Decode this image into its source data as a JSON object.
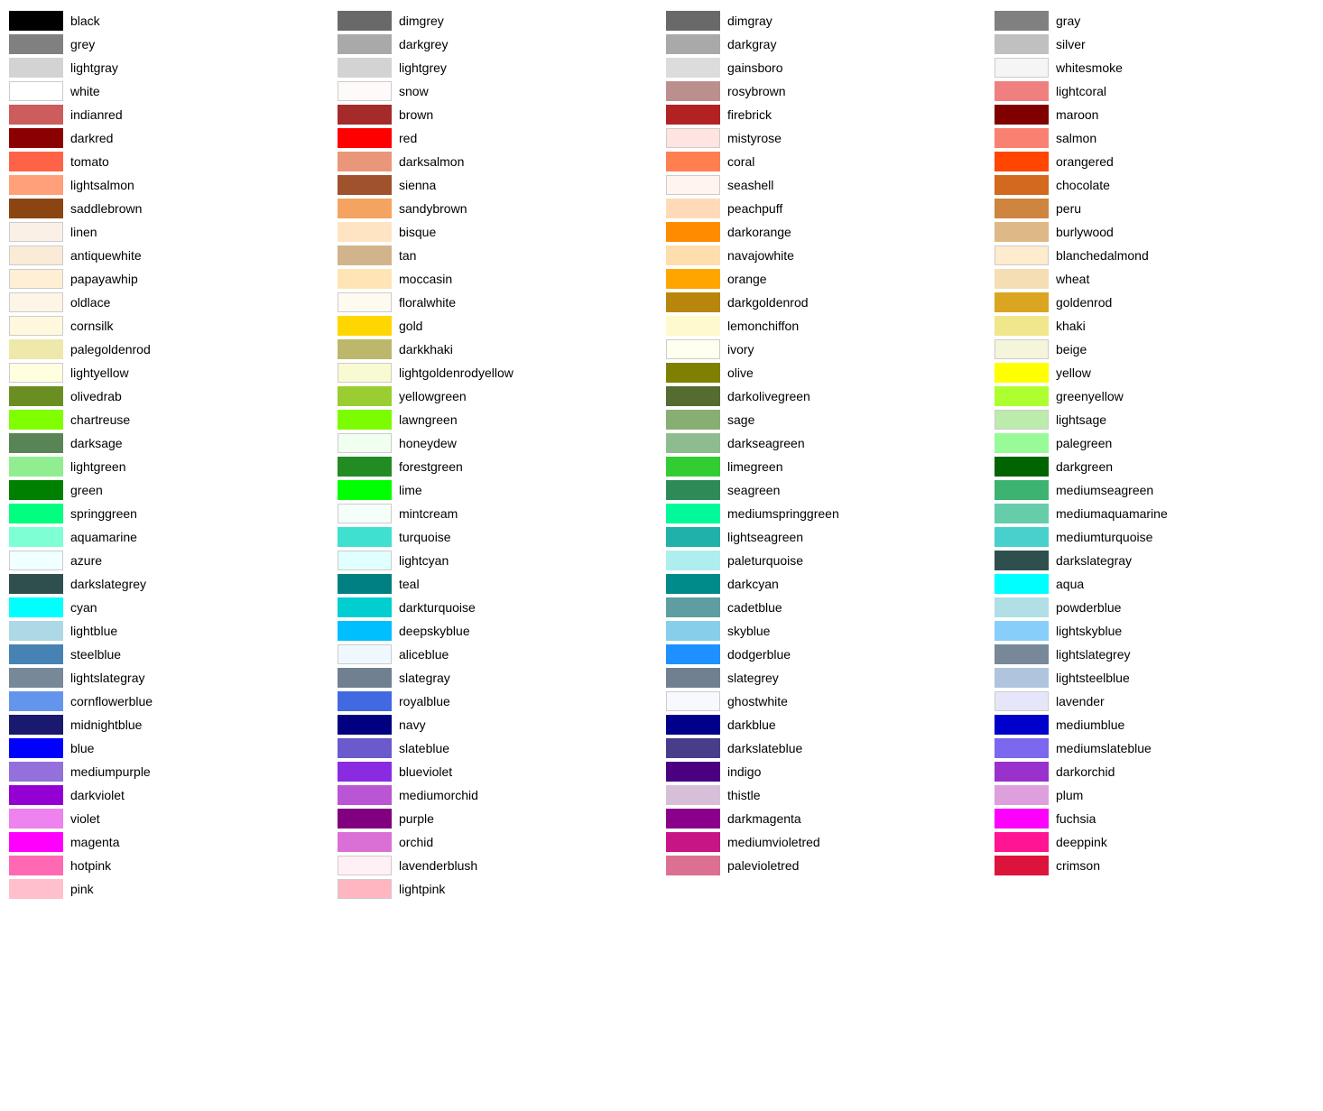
{
  "columns": [
    {
      "id": "col1",
      "items": [
        {
          "name": "black",
          "color": "#000000"
        },
        {
          "name": "grey",
          "color": "#808080"
        },
        {
          "name": "lightgray",
          "color": "#d3d3d3"
        },
        {
          "name": "white",
          "color": "#ffffff"
        },
        {
          "name": "indianred",
          "color": "#cd5c5c"
        },
        {
          "name": "darkred",
          "color": "#8b0000"
        },
        {
          "name": "tomato",
          "color": "#ff6347"
        },
        {
          "name": "lightsalmon",
          "color": "#ffa07a"
        },
        {
          "name": "saddlebrown",
          "color": "#8b4513"
        },
        {
          "name": "linen",
          "color": "#faf0e6"
        },
        {
          "name": "antiquewhite",
          "color": "#faebd7"
        },
        {
          "name": "papayawhip",
          "color": "#ffefd5"
        },
        {
          "name": "oldlace",
          "color": "#fdf5e6"
        },
        {
          "name": "cornsilk",
          "color": "#fff8dc"
        },
        {
          "name": "palegoldenrod",
          "color": "#eee8aa"
        },
        {
          "name": "lightyellow",
          "color": "#ffffe0"
        },
        {
          "name": "olivedrab",
          "color": "#6b8e23"
        },
        {
          "name": "chartreuse",
          "color": "#7fff00"
        },
        {
          "name": "darksage",
          "color": "#598556"
        },
        {
          "name": "lightgreen",
          "color": "#90ee90"
        },
        {
          "name": "green",
          "color": "#008000"
        },
        {
          "name": "springgreen",
          "color": "#00ff7f"
        },
        {
          "name": "aquamarine",
          "color": "#7fffd4"
        },
        {
          "name": "azure",
          "color": "#f0ffff"
        },
        {
          "name": "darkslategrey",
          "color": "#2f4f4f"
        },
        {
          "name": "cyan",
          "color": "#00ffff"
        },
        {
          "name": "lightblue",
          "color": "#add8e6"
        },
        {
          "name": "steelblue",
          "color": "#4682b4"
        },
        {
          "name": "lightslategray",
          "color": "#778899"
        },
        {
          "name": "cornflowerblue",
          "color": "#6495ed"
        },
        {
          "name": "midnightblue",
          "color": "#191970"
        },
        {
          "name": "blue",
          "color": "#0000ff"
        },
        {
          "name": "mediumpurple",
          "color": "#9370db"
        },
        {
          "name": "darkviolet",
          "color": "#9400d3"
        },
        {
          "name": "violet",
          "color": "#ee82ee"
        },
        {
          "name": "magenta",
          "color": "#ff00ff"
        },
        {
          "name": "hotpink",
          "color": "#ff69b4"
        },
        {
          "name": "pink",
          "color": "#ffc0cb"
        }
      ]
    },
    {
      "id": "col2",
      "items": [
        {
          "name": "dimgrey",
          "color": "#696969"
        },
        {
          "name": "darkgrey",
          "color": "#a9a9a9"
        },
        {
          "name": "lightgrey",
          "color": "#d3d3d3"
        },
        {
          "name": "snow",
          "color": "#fffafa"
        },
        {
          "name": "brown",
          "color": "#a52a2a"
        },
        {
          "name": "red",
          "color": "#ff0000"
        },
        {
          "name": "darksalmon",
          "color": "#e9967a"
        },
        {
          "name": "sienna",
          "color": "#a0522d"
        },
        {
          "name": "sandybrown",
          "color": "#f4a460"
        },
        {
          "name": "bisque",
          "color": "#ffe4c4"
        },
        {
          "name": "tan",
          "color": "#d2b48c"
        },
        {
          "name": "moccasin",
          "color": "#ffe4b5"
        },
        {
          "name": "floralwhite",
          "color": "#fffaf0"
        },
        {
          "name": "gold",
          "color": "#ffd700"
        },
        {
          "name": "darkkhaki",
          "color": "#bdb76b"
        },
        {
          "name": "lightgoldenrodyellow",
          "color": "#fafad2"
        },
        {
          "name": "yellowgreen",
          "color": "#9acd32"
        },
        {
          "name": "lawngreen",
          "color": "#7cfc00"
        },
        {
          "name": "honeydew",
          "color": "#f0fff0"
        },
        {
          "name": "forestgreen",
          "color": "#228b22"
        },
        {
          "name": "lime",
          "color": "#00ff00"
        },
        {
          "name": "mintcream",
          "color": "#f5fffa"
        },
        {
          "name": "turquoise",
          "color": "#40e0d0"
        },
        {
          "name": "lightcyan",
          "color": "#e0ffff"
        },
        {
          "name": "teal",
          "color": "#008080"
        },
        {
          "name": "darkturquoise",
          "color": "#00ced1"
        },
        {
          "name": "deepskyblue",
          "color": "#00bfff"
        },
        {
          "name": "aliceblue",
          "color": "#f0f8ff"
        },
        {
          "name": "slategray",
          "color": "#708090"
        },
        {
          "name": "royalblue",
          "color": "#4169e1"
        },
        {
          "name": "navy",
          "color": "#000080"
        },
        {
          "name": "slateblue",
          "color": "#6a5acd"
        },
        {
          "name": "blueviolet",
          "color": "#8a2be2"
        },
        {
          "name": "mediumorchid",
          "color": "#ba55d3"
        },
        {
          "name": "purple",
          "color": "#800080"
        },
        {
          "name": "orchid",
          "color": "#da70d6"
        },
        {
          "name": "lavenderblush",
          "color": "#fff0f5"
        },
        {
          "name": "lightpink",
          "color": "#ffb6c1"
        }
      ]
    },
    {
      "id": "col3",
      "items": [
        {
          "name": "dimgray",
          "color": "#696969"
        },
        {
          "name": "darkgray",
          "color": "#a9a9a9"
        },
        {
          "name": "gainsboro",
          "color": "#dcdcdc"
        },
        {
          "name": "rosybrown",
          "color": "#bc8f8f"
        },
        {
          "name": "firebrick",
          "color": "#b22222"
        },
        {
          "name": "mistyrose",
          "color": "#ffe4e1"
        },
        {
          "name": "coral",
          "color": "#ff7f50"
        },
        {
          "name": "seashell",
          "color": "#fff5ee"
        },
        {
          "name": "peachpuff",
          "color": "#ffdab9"
        },
        {
          "name": "darkorange",
          "color": "#ff8c00"
        },
        {
          "name": "navajowhite",
          "color": "#ffdead"
        },
        {
          "name": "orange",
          "color": "#ffa500"
        },
        {
          "name": "darkgoldenrod",
          "color": "#b8860b"
        },
        {
          "name": "lemonchiffon",
          "color": "#fffacd"
        },
        {
          "name": "ivory",
          "color": "#fffff0"
        },
        {
          "name": "olive",
          "color": "#808000"
        },
        {
          "name": "darkolivegreen",
          "color": "#556b2f"
        },
        {
          "name": "sage",
          "color": "#87ae73"
        },
        {
          "name": "darkseagreen",
          "color": "#8fbc8f"
        },
        {
          "name": "limegreen",
          "color": "#32cd32"
        },
        {
          "name": "seagreen",
          "color": "#2e8b57"
        },
        {
          "name": "mediumspringgreen",
          "color": "#00fa9a"
        },
        {
          "name": "lightseagreen",
          "color": "#20b2aa"
        },
        {
          "name": "paleturquoise",
          "color": "#afeeee"
        },
        {
          "name": "darkcyan",
          "color": "#008b8b"
        },
        {
          "name": "cadetblue",
          "color": "#5f9ea0"
        },
        {
          "name": "skyblue",
          "color": "#87ceeb"
        },
        {
          "name": "dodgerblue",
          "color": "#1e90ff"
        },
        {
          "name": "slategrey",
          "color": "#708090"
        },
        {
          "name": "ghostwhite",
          "color": "#f8f8ff"
        },
        {
          "name": "darkblue",
          "color": "#00008b"
        },
        {
          "name": "darkslateblue",
          "color": "#483d8b"
        },
        {
          "name": "indigo",
          "color": "#4b0082"
        },
        {
          "name": "thistle",
          "color": "#d8bfd8"
        },
        {
          "name": "darkmagenta",
          "color": "#8b008b"
        },
        {
          "name": "mediumvioletred",
          "color": "#c71585"
        },
        {
          "name": "palevioletred",
          "color": "#db7093"
        }
      ]
    },
    {
      "id": "col4",
      "items": [
        {
          "name": "gray",
          "color": "#808080"
        },
        {
          "name": "silver",
          "color": "#c0c0c0"
        },
        {
          "name": "whitesmoke",
          "color": "#f5f5f5"
        },
        {
          "name": "lightcoral",
          "color": "#f08080"
        },
        {
          "name": "maroon",
          "color": "#800000"
        },
        {
          "name": "salmon",
          "color": "#fa8072"
        },
        {
          "name": "orangered",
          "color": "#ff4500"
        },
        {
          "name": "chocolate",
          "color": "#d2691e"
        },
        {
          "name": "peru",
          "color": "#cd853f"
        },
        {
          "name": "burlywood",
          "color": "#deb887"
        },
        {
          "name": "blanchedalmond",
          "color": "#ffebcd"
        },
        {
          "name": "wheat",
          "color": "#f5deb3"
        },
        {
          "name": "goldenrod",
          "color": "#daa520"
        },
        {
          "name": "khaki",
          "color": "#f0e68c"
        },
        {
          "name": "beige",
          "color": "#f5f5dc"
        },
        {
          "name": "yellow",
          "color": "#ffff00"
        },
        {
          "name": "greenyellow",
          "color": "#adff2f"
        },
        {
          "name": "lightsage",
          "color": "#bcecac"
        },
        {
          "name": "palegreen",
          "color": "#98fb98"
        },
        {
          "name": "darkgreen",
          "color": "#006400"
        },
        {
          "name": "mediumseagreen",
          "color": "#3cb371"
        },
        {
          "name": "mediumaquamarine",
          "color": "#66cdaa"
        },
        {
          "name": "mediumturquoise",
          "color": "#48d1cc"
        },
        {
          "name": "darkslategray",
          "color": "#2f4f4f"
        },
        {
          "name": "aqua",
          "color": "#00ffff"
        },
        {
          "name": "powderblue",
          "color": "#b0e0e6"
        },
        {
          "name": "lightskyblue",
          "color": "#87cefa"
        },
        {
          "name": "lightslategrey",
          "color": "#778899"
        },
        {
          "name": "lightsteelblue",
          "color": "#b0c4de"
        },
        {
          "name": "lavender",
          "color": "#e6e6fa"
        },
        {
          "name": "mediumblue",
          "color": "#0000cd"
        },
        {
          "name": "mediumslateblue",
          "color": "#7b68ee"
        },
        {
          "name": "darkorchid",
          "color": "#9932cc"
        },
        {
          "name": "plum",
          "color": "#dda0dd"
        },
        {
          "name": "fuchsia",
          "color": "#ff00ff"
        },
        {
          "name": "deeppink",
          "color": "#ff1493"
        },
        {
          "name": "crimson",
          "color": "#dc143c"
        }
      ]
    }
  ]
}
